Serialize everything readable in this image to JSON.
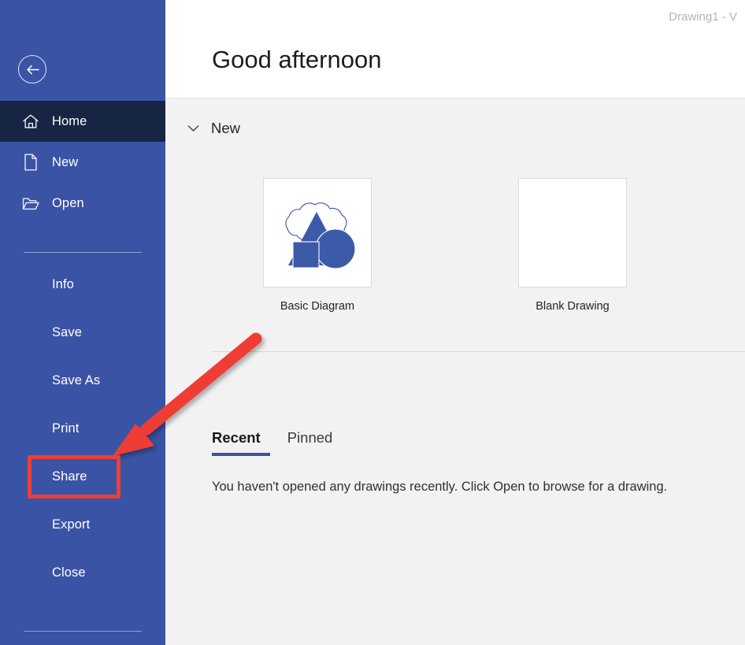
{
  "window": {
    "title": "Drawing1  -  V"
  },
  "header": {
    "greeting": "Good afternoon"
  },
  "sidebar": {
    "back_icon": "back-arrow-icon",
    "top_items": [
      {
        "label": "Home",
        "icon": "home-icon",
        "active": true
      },
      {
        "label": "New",
        "icon": "new-document-icon",
        "active": false
      },
      {
        "label": "Open",
        "icon": "open-folder-icon",
        "active": false
      }
    ],
    "sub_items": [
      {
        "label": "Info"
      },
      {
        "label": "Save"
      },
      {
        "label": "Save As"
      },
      {
        "label": "Print"
      },
      {
        "label": "Share"
      },
      {
        "label": "Export"
      },
      {
        "label": "Close"
      }
    ]
  },
  "main": {
    "new_section": {
      "title": "New",
      "chevron_icon": "chevron-down-icon",
      "templates": [
        {
          "name": "Basic Diagram",
          "thumb": "basic-diagram-thumbnail"
        },
        {
          "name": "Blank Drawing",
          "thumb": "blank-drawing-thumbnail"
        }
      ]
    },
    "tabs": [
      {
        "label": "Recent",
        "selected": true
      },
      {
        "label": "Pinned",
        "selected": false
      }
    ],
    "empty_message": "You haven't opened any drawings recently. Click Open to browse for a drawing."
  },
  "colors": {
    "sidebar_blue": "#3b53a4",
    "sidebar_active": "#152543",
    "accent": "#3b53a4",
    "content_bg": "#f2f2f2",
    "annotation_red": "#ef3e36"
  },
  "annotations": {
    "highlight_target": "Share",
    "arrow": "red-arrow-pointing-to-share"
  }
}
